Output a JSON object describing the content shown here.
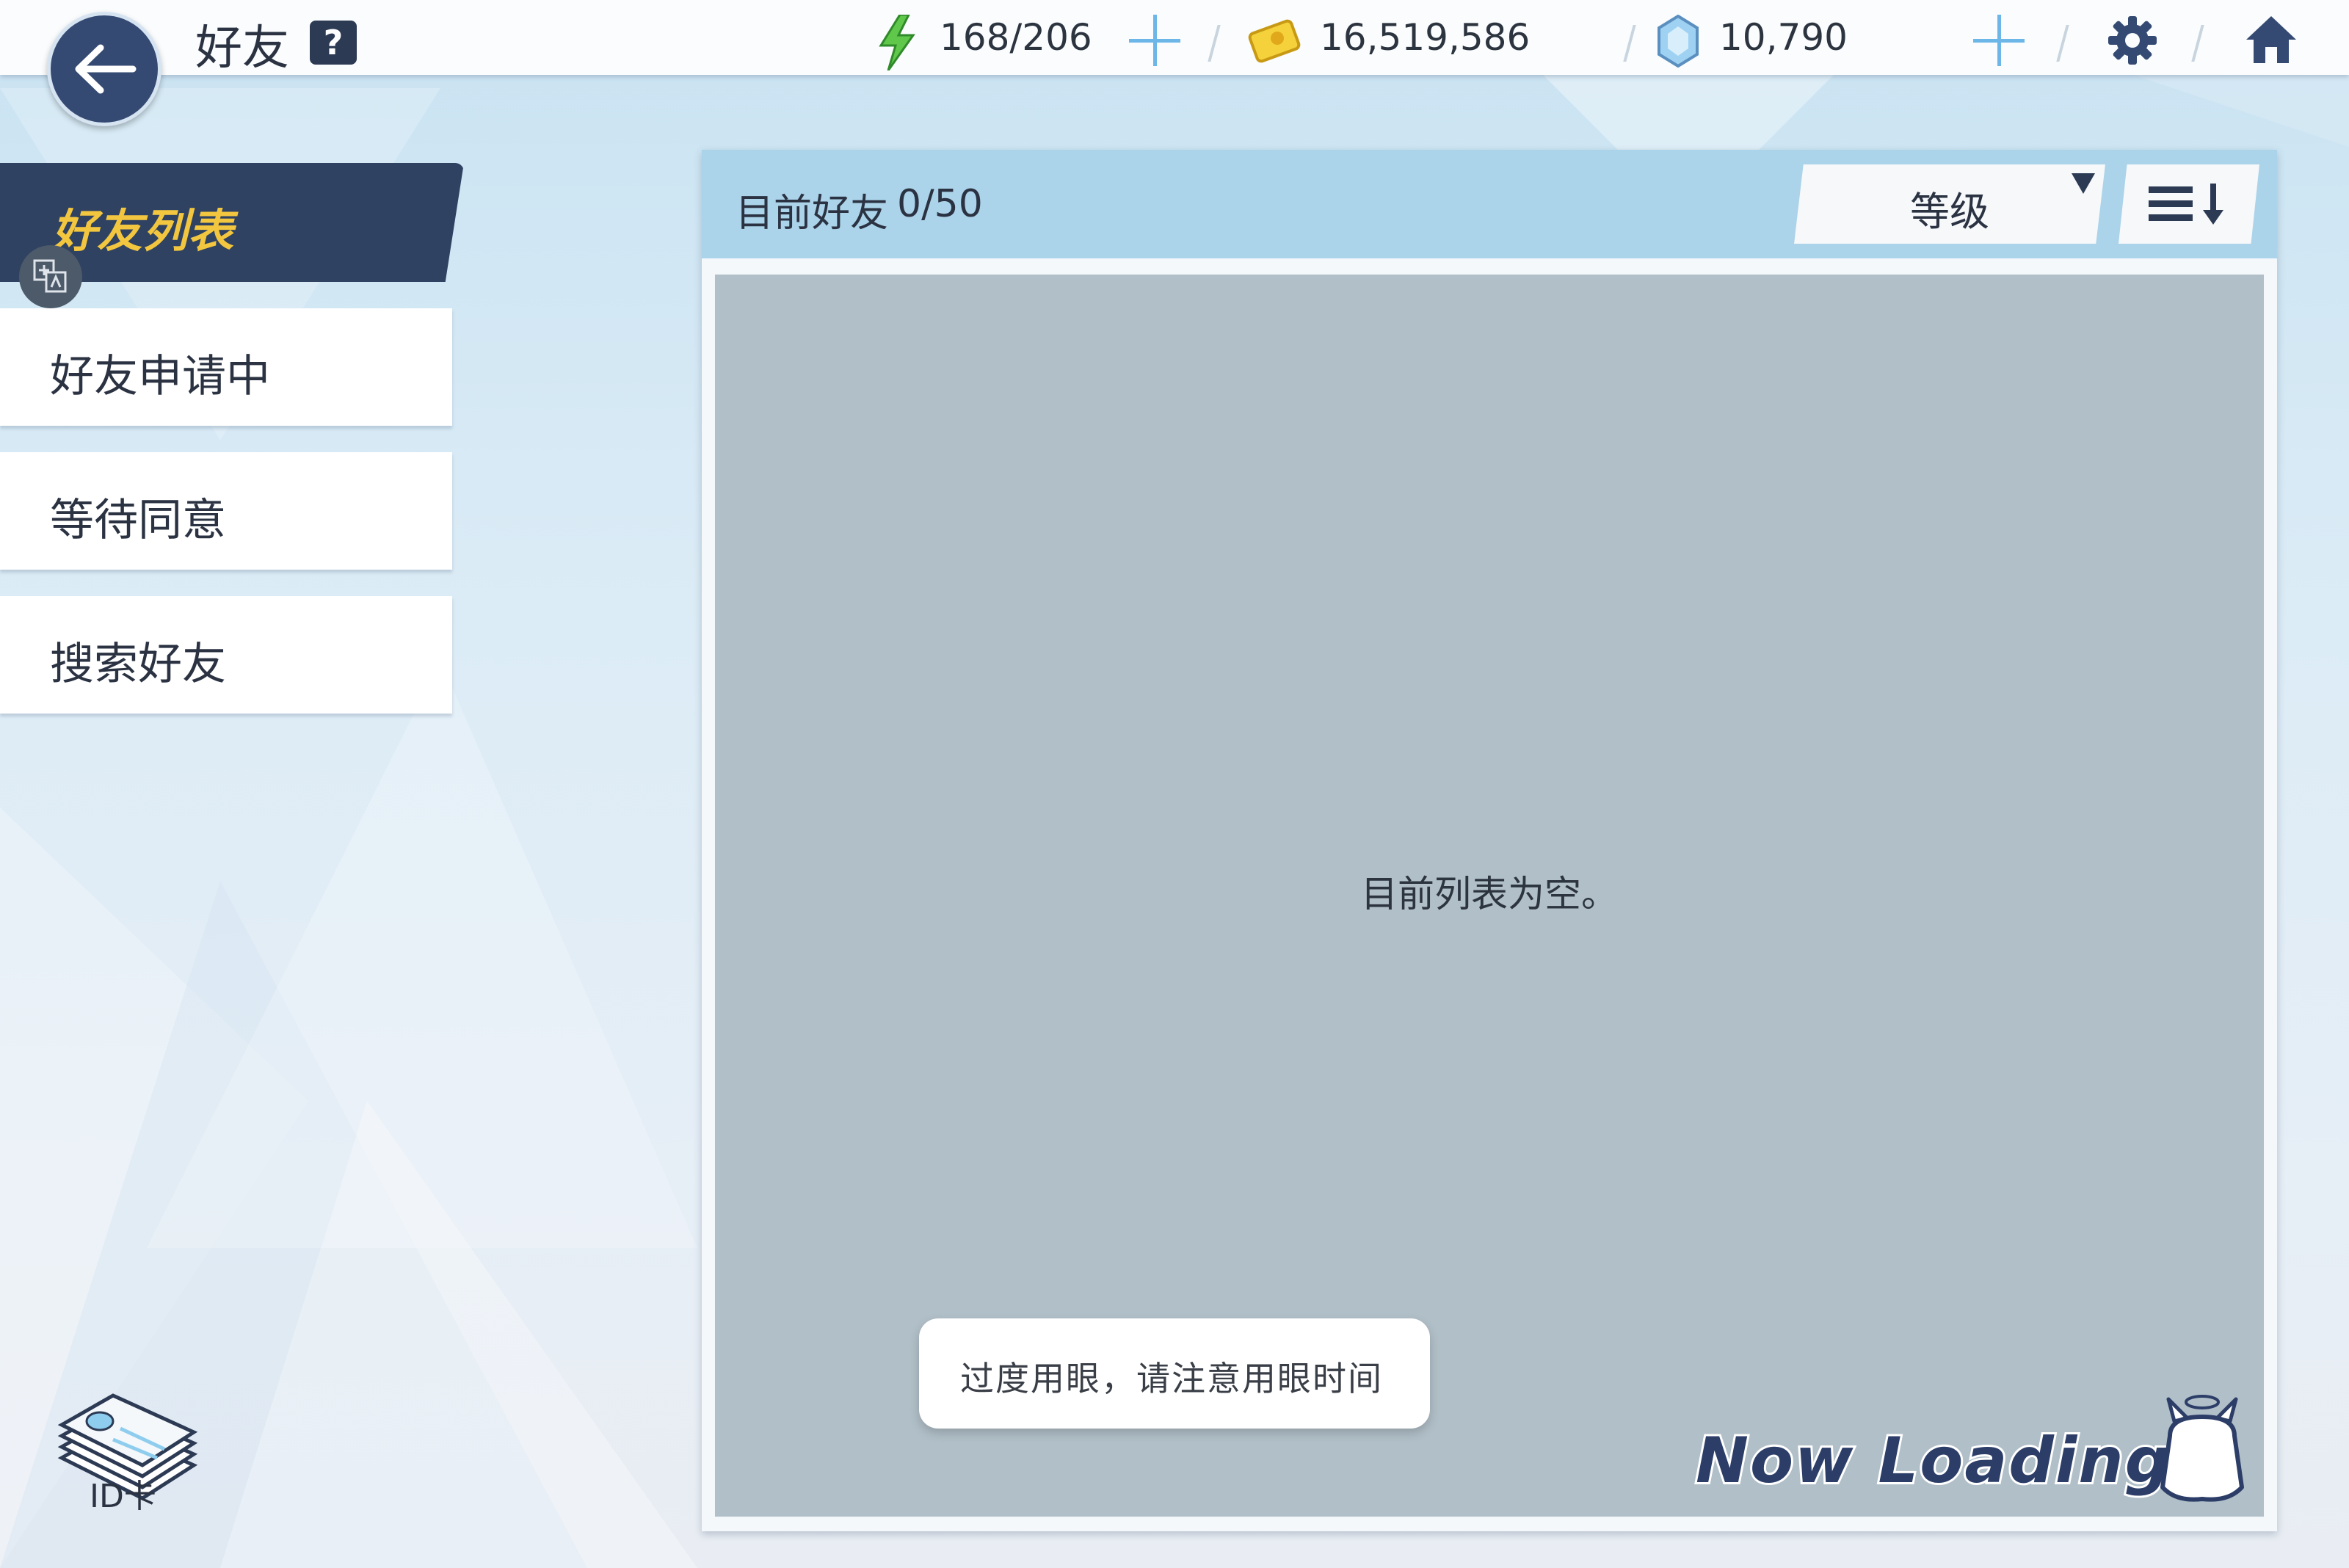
{
  "header": {
    "title": "好友",
    "help_icon": "?",
    "stamina": "168/206",
    "coins": "16,519,586",
    "gems": "10,790"
  },
  "sidebar": {
    "items": [
      {
        "label": "好友列表",
        "active": true
      },
      {
        "label": "好友申请中",
        "active": false
      },
      {
        "label": "等待同意",
        "active": false
      },
      {
        "label": "搜索好友",
        "active": false
      }
    ],
    "id_card_label": "ID卡"
  },
  "main": {
    "friend_count_label": "目前好友",
    "friend_count_value": "0/50",
    "sort_selected": "等级",
    "empty_message": "目前列表为空。"
  },
  "toast": {
    "text": "过度用眼，请注意用眼时间"
  },
  "loading": {
    "text": "Now Loading..."
  },
  "colors": {
    "accent_dark": "#2f4261",
    "active_text": "#f3c63f",
    "header_blue": "#abd3e9"
  }
}
